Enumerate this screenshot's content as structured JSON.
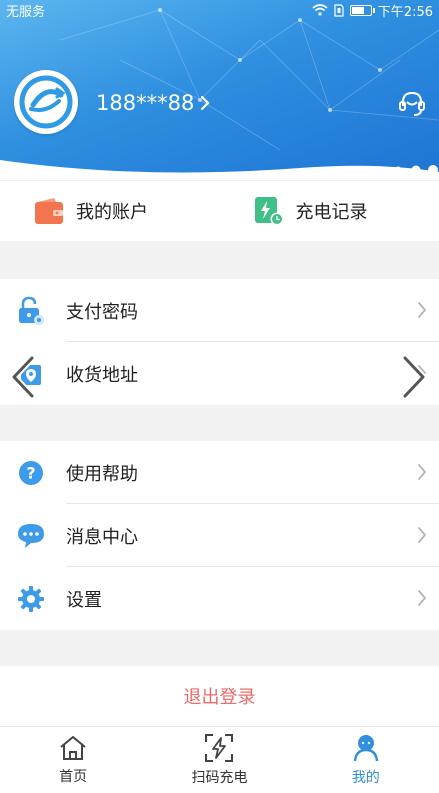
{
  "status_bar": {
    "carrier": "无服务",
    "time": "下午2:56"
  },
  "profile": {
    "phone": "188***88"
  },
  "quick_actions": [
    {
      "label": "我的账户",
      "icon": "wallet-icon"
    },
    {
      "label": "充电记录",
      "icon": "charge-record-icon"
    }
  ],
  "menu_group_1": [
    {
      "label": "支付密码",
      "icon": "lock-icon"
    },
    {
      "label": "收货地址",
      "icon": "address-icon"
    }
  ],
  "menu_group_2": [
    {
      "label": "使用帮助",
      "icon": "help-icon"
    },
    {
      "label": "消息中心",
      "icon": "message-icon"
    },
    {
      "label": "设置",
      "icon": "gear-icon"
    }
  ],
  "logout_label": "退出登录",
  "tabs": [
    {
      "label": "首页",
      "icon": "home-icon"
    },
    {
      "label": "扫码充电",
      "icon": "scan-charge-icon"
    },
    {
      "label": "我的",
      "icon": "profile-icon",
      "active": true
    }
  ],
  "colors": {
    "accent": "#2f8fe0",
    "logout": "#ec6a6a",
    "wallet": "#f2754f",
    "charge_record": "#3fc089"
  }
}
